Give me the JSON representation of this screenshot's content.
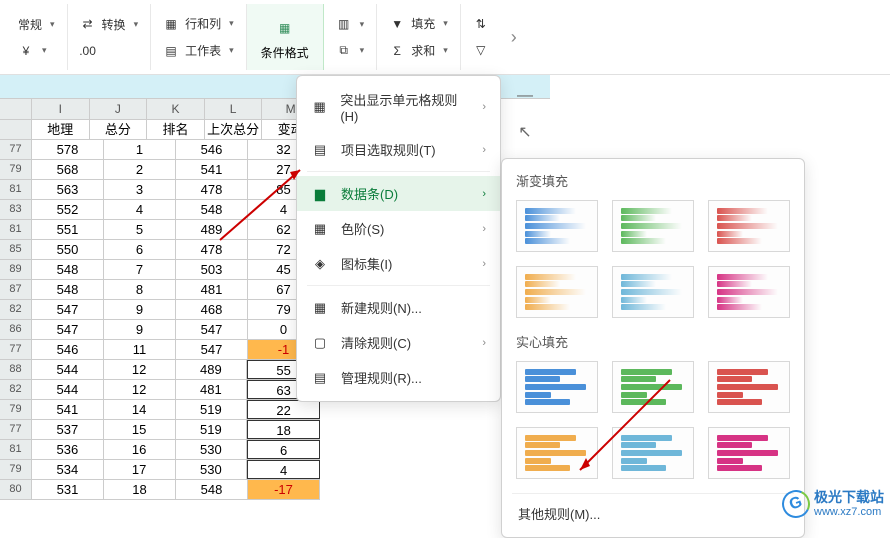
{
  "ribbon": {
    "style_label": "常规",
    "convert_label": "转换",
    "rowcol_label": "行和列",
    "worksheet_label": "工作表",
    "cond_fmt_label": "条件格式",
    "fill_label": "填充",
    "sum_label": "求和",
    "freeze_icon": "冻结",
    "crop_icon": "裁剪"
  },
  "columns": [
    "I",
    "J",
    "K",
    "L",
    "M"
  ],
  "table": {
    "headers": [
      "地理",
      "总分",
      "排名",
      "上次总分",
      "变动"
    ],
    "rows": [
      {
        "hdr": "77",
        "total": "578",
        "rank": "1",
        "prev": "546",
        "delta": "32"
      },
      {
        "hdr": "79",
        "total": "568",
        "rank": "2",
        "prev": "541",
        "delta": "27"
      },
      {
        "hdr": "81",
        "total": "563",
        "rank": "3",
        "prev": "478",
        "delta": "85"
      },
      {
        "hdr": "83",
        "total": "552",
        "rank": "4",
        "prev": "548",
        "delta": "4"
      },
      {
        "hdr": "81",
        "total": "551",
        "rank": "5",
        "prev": "489",
        "delta": "62"
      },
      {
        "hdr": "85",
        "total": "550",
        "rank": "6",
        "prev": "478",
        "delta": "72"
      },
      {
        "hdr": "89",
        "total": "548",
        "rank": "7",
        "prev": "503",
        "delta": "45"
      },
      {
        "hdr": "87",
        "total": "548",
        "rank": "8",
        "prev": "481",
        "delta": "67"
      },
      {
        "hdr": "82",
        "total": "547",
        "rank": "9",
        "prev": "468",
        "delta": "79"
      },
      {
        "hdr": "86",
        "total": "547",
        "rank": "9",
        "prev": "547",
        "delta": "0"
      },
      {
        "hdr": "77",
        "total": "546",
        "rank": "11",
        "prev": "547",
        "delta": "-1",
        "neg": true
      },
      {
        "hdr": "88",
        "total": "544",
        "rank": "12",
        "prev": "489",
        "delta": "55",
        "boxed": true
      },
      {
        "hdr": "82",
        "total": "544",
        "rank": "12",
        "prev": "481",
        "delta": "63",
        "boxed": true
      },
      {
        "hdr": "79",
        "total": "541",
        "rank": "14",
        "prev": "519",
        "delta": "22",
        "boxed": true
      },
      {
        "hdr": "77",
        "total": "537",
        "rank": "15",
        "prev": "519",
        "delta": "18",
        "boxed": true
      },
      {
        "hdr": "81",
        "total": "536",
        "rank": "16",
        "prev": "530",
        "delta": "6",
        "boxed": true
      },
      {
        "hdr": "79",
        "total": "534",
        "rank": "17",
        "prev": "530",
        "delta": "4",
        "boxed": true
      },
      {
        "hdr": "80",
        "total": "531",
        "rank": "18",
        "prev": "548",
        "delta": "-17",
        "neg": true
      }
    ]
  },
  "menu": {
    "highlight": "突出显示单元格规则(H)",
    "toprules": "项目选取规则(T)",
    "databars": "数据条(D)",
    "colorscales": "色阶(S)",
    "iconsets": "图标集(I)",
    "newrule": "新建规则(N)...",
    "clearrules": "清除规则(C)",
    "managerules": "管理规则(R)..."
  },
  "panel": {
    "gradient_title": "渐变填充",
    "solid_title": "实心填充",
    "other_rules": "其他规则(M)...",
    "colors_row1": [
      "#4a90d9",
      "#5cb85c",
      "#d9534f"
    ],
    "colors_row2": [
      "#f0ad4e",
      "#6fb7d9",
      "#d63384"
    ]
  },
  "watermark": {
    "name": "极光下载站",
    "url": "www.xz7.com"
  }
}
